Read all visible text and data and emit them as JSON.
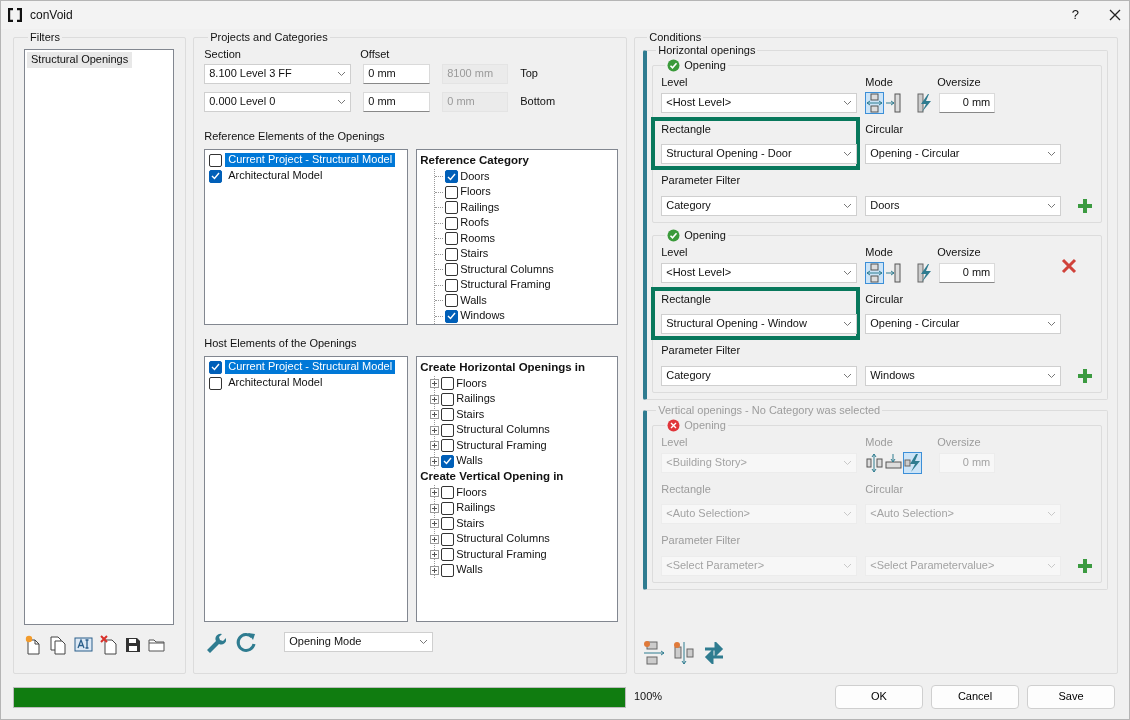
{
  "window": {
    "title": "conVoid",
    "help": "?"
  },
  "filters": {
    "title": "Filters",
    "items": [
      {
        "label": "Structural Openings",
        "selected": true
      }
    ]
  },
  "projects": {
    "title": "Projects and Categories",
    "section_label": "Section",
    "offset_label": "Offset",
    "levels": [
      {
        "section": "8.100  Level 3 FF",
        "offset": "0 mm",
        "elevation": "8100 mm",
        "position": "Top"
      },
      {
        "section": "0.000  Level 0",
        "offset": "0 mm",
        "elevation": "0 mm",
        "position": "Bottom"
      }
    ],
    "reference": {
      "title": "Reference Elements of the Openings",
      "models": [
        {
          "label": "Current Project - Structural Model",
          "checked": false,
          "selected": true
        },
        {
          "label": "Architectural Model",
          "checked": true,
          "selected": false
        }
      ],
      "tree": [
        {
          "title": "Reference Category",
          "items": [
            {
              "label": "Doors",
              "checked": true,
              "expandable": false
            },
            {
              "label": "Floors",
              "checked": false,
              "expandable": false
            },
            {
              "label": "Railings",
              "checked": false,
              "expandable": false
            },
            {
              "label": "Roofs",
              "checked": false,
              "expandable": false
            },
            {
              "label": "Rooms",
              "checked": false,
              "expandable": false
            },
            {
              "label": "Stairs",
              "checked": false,
              "expandable": false
            },
            {
              "label": "Structural Columns",
              "checked": false,
              "expandable": false
            },
            {
              "label": "Structural Framing",
              "checked": false,
              "expandable": false
            },
            {
              "label": "Walls",
              "checked": false,
              "expandable": false
            },
            {
              "label": "Windows",
              "checked": true,
              "expandable": false
            }
          ]
        }
      ]
    },
    "host": {
      "title": "Host Elements of the Openings",
      "models": [
        {
          "label": "Current Project - Structural Model",
          "checked": true,
          "selected": true
        },
        {
          "label": "Architectural Model",
          "checked": false,
          "selected": false
        }
      ],
      "tree": [
        {
          "title": "Create Horizontal Openings in",
          "items": [
            {
              "label": "Floors",
              "checked": false,
              "expandable": true
            },
            {
              "label": "Railings",
              "checked": false,
              "expandable": true
            },
            {
              "label": "Stairs",
              "checked": false,
              "expandable": true
            },
            {
              "label": "Structural Columns",
              "checked": false,
              "expandable": true
            },
            {
              "label": "Structural Framing",
              "checked": false,
              "expandable": true
            },
            {
              "label": "Walls",
              "checked": true,
              "expandable": true
            }
          ]
        },
        {
          "title": "Create Vertical Opening in",
          "items": [
            {
              "label": "Floors",
              "checked": false,
              "expandable": true
            },
            {
              "label": "Railings",
              "checked": false,
              "expandable": true
            },
            {
              "label": "Stairs",
              "checked": false,
              "expandable": true
            },
            {
              "label": "Structural Columns",
              "checked": false,
              "expandable": true
            },
            {
              "label": "Structural Framing",
              "checked": false,
              "expandable": true
            },
            {
              "label": "Walls",
              "checked": false,
              "expandable": true
            }
          ]
        }
      ]
    },
    "mode_select": "Opening Mode"
  },
  "conditions": {
    "title": "Conditions",
    "groups": [
      {
        "title": "Horizontal openings",
        "enabled": true,
        "kind": "horizontal",
        "openings": [
          {
            "title": "Opening",
            "valid": true,
            "level_label": "Level",
            "level": "<Host Level>",
            "mode_label": "Mode",
            "modes": [
              {
                "selected": true
              },
              {
                "selected": false
              },
              {
                "selected": false
              }
            ],
            "oversize_label": "Oversize",
            "oversize": "0 mm",
            "rectangle_label": "Rectangle",
            "rectangle": "Structural Opening - Door",
            "highlighted": true,
            "circular_label": "Circular",
            "circular": "Opening - Circular",
            "filter_label": "Parameter Filter",
            "filter_parameter": "Category",
            "filter_value": "Doors",
            "removable": false
          },
          {
            "title": "Opening",
            "valid": true,
            "level_label": "Level",
            "level": "<Host Level>",
            "mode_label": "Mode",
            "modes": [
              {
                "selected": true
              },
              {
                "selected": false
              },
              {
                "selected": false
              }
            ],
            "oversize_label": "Oversize",
            "oversize": "0 mm",
            "rectangle_label": "Rectangle",
            "rectangle": "Structural Opening - Window",
            "highlighted": true,
            "circular_label": "Circular",
            "circular": "Opening - Circular",
            "filter_label": "Parameter Filter",
            "filter_parameter": "Category",
            "filter_value": "Windows",
            "removable": true
          }
        ]
      },
      {
        "title": "Vertical openings - No Category was selected",
        "enabled": false,
        "kind": "vertical",
        "openings": [
          {
            "title": "Opening",
            "valid": false,
            "level_label": "Level",
            "level": "<Building Story>",
            "mode_label": "Mode",
            "modes": [
              {
                "selected": false
              },
              {
                "selected": false
              },
              {
                "selected": true
              }
            ],
            "oversize_label": "Oversize",
            "oversize": "0 mm",
            "rectangle_label": "Rectangle",
            "rectangle": "<Auto Selection>",
            "highlighted": false,
            "circular_label": "Circular",
            "circular": "<Auto Selection>",
            "filter_label": "Parameter Filter",
            "filter_parameter": "<Select Parameter>",
            "filter_value": "<Select Parametervalue>",
            "removable": false
          }
        ]
      }
    ]
  },
  "progress": {
    "level": 1,
    "reading": "100%"
  },
  "buttons": [
    {
      "label": "OK"
    },
    {
      "label": "Cancel"
    },
    {
      "label": "Save"
    }
  ]
}
